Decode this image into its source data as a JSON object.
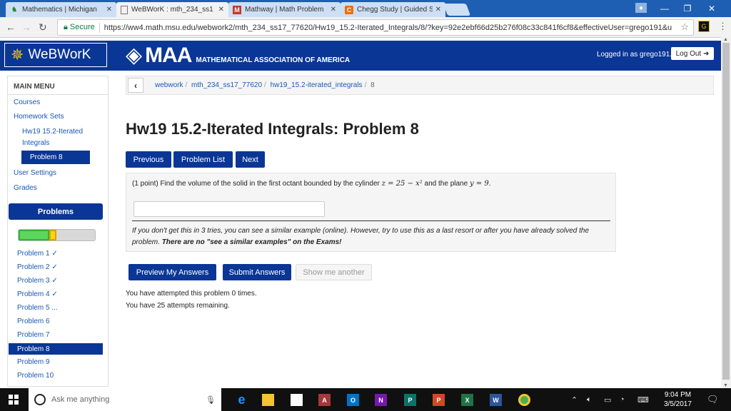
{
  "browser": {
    "tabs": [
      {
        "title": "Mathematics | Michigan",
        "icon": "michigan-icon",
        "active": false
      },
      {
        "title": "WeBWorK : mth_234_ss1",
        "icon": "page-icon",
        "active": true
      },
      {
        "title": "Mathway | Math Problem",
        "icon": "mathway-icon",
        "active": false
      },
      {
        "title": "Chegg Study | Guided Sc",
        "icon": "chegg-icon",
        "active": false
      }
    ],
    "secure_label": "Secure",
    "url": "https://ww4.math.msu.edu/webwork2/mth_234_ss17_77620/Hw19_15.2-Iterated_Integrals/8/?key=92e2ebf66d25b276f08c33c841f6cf8&effectiveUser=grego191&u",
    "extension_label": "G",
    "colors": {
      "tabstrip": "#1e5fb3",
      "tab_inactive": "#cddff4",
      "secure": "#0b8043"
    }
  },
  "header": {
    "logo_text": "WeBWorK",
    "maa_logo": "MAA",
    "maa_subtitle": "MATHEMATICAL ASSOCIATION OF AMERICA",
    "logged_in": "Logged in as grego191.",
    "logout_label": "Log Out ➜",
    "colors": {
      "bar": "#0a3696"
    }
  },
  "sidebar": {
    "title": "MAIN MENU",
    "courses": "Courses",
    "homework_sets": "Homework Sets",
    "set_name_line1": "Hw19 15.2-Iterated",
    "set_name_line2": "Integrals",
    "current_problem": "Problem 8",
    "user_settings": "User Settings",
    "grades": "Grades",
    "problems_heading": "Problems",
    "progress": {
      "correct_fraction": 0.4,
      "attempted_fraction": 0.1
    },
    "problem_links": [
      "Problem 1 ✓",
      "Problem 2 ✓",
      "Problem 3 ✓",
      "Problem 4 ✓",
      "Problem 5 ...",
      "Problem 6",
      "Problem 7",
      "Problem 8",
      "Problem 9",
      "Problem 10"
    ]
  },
  "main": {
    "breadcrumb": [
      "webwork",
      "mth_234_ss17_77620",
      "hw19_15.2-iterated_integrals",
      "8"
    ],
    "title": "Hw19 15.2-Iterated Integrals: Problem 8",
    "buttons": {
      "previous": "Previous",
      "problem_list": "Problem List",
      "next": "Next"
    },
    "problem_pre": "(1 point) Find the volume of the solid in the first octant bounded by the cylinder ",
    "problem_math1": "z = 25 − x²",
    "problem_mid": " and the plane ",
    "problem_math2": "y = 9",
    "problem_post": ".",
    "answer_value": "",
    "note_text": "If you don't get this in 3 tries, you can see a similar example (online). However, try to use this as a last resort or after you have already solved the problem. ",
    "note_bold": "There are no \"see a similar examples\" on the Exams!",
    "actions": {
      "preview": "Preview My Answers",
      "submit": "Submit Answers",
      "show_another": "Show me another"
    },
    "attempted": "You have attempted this problem 0 times.",
    "remaining": "You have 25 attempts remaining."
  },
  "taskbar": {
    "search_placeholder": "Ask me anything",
    "time": "9:04 PM",
    "date": "3/5/2017",
    "apps": [
      {
        "icon": "edge-icon",
        "label": "e",
        "color": "#1e90ff"
      },
      {
        "icon": "file-explorer-icon",
        "label": "",
        "color": "#f4c430"
      },
      {
        "icon": "store-icon",
        "label": "",
        "color": "#ffffff"
      },
      {
        "icon": "access-icon",
        "label": "A",
        "color": "#a4373a"
      },
      {
        "icon": "outlook-icon",
        "label": "O",
        "color": "#0072c6"
      },
      {
        "icon": "onenote-icon",
        "label": "N",
        "color": "#7719aa"
      },
      {
        "icon": "publisher-icon",
        "label": "P",
        "color": "#077568"
      },
      {
        "icon": "powerpoint-icon",
        "label": "P",
        "color": "#d24726"
      },
      {
        "icon": "excel-icon",
        "label": "X",
        "color": "#217346"
      },
      {
        "icon": "word-icon",
        "label": "W",
        "color": "#2b579a"
      },
      {
        "icon": "chrome-icon",
        "label": "",
        "color": "#4caf50"
      }
    ]
  }
}
